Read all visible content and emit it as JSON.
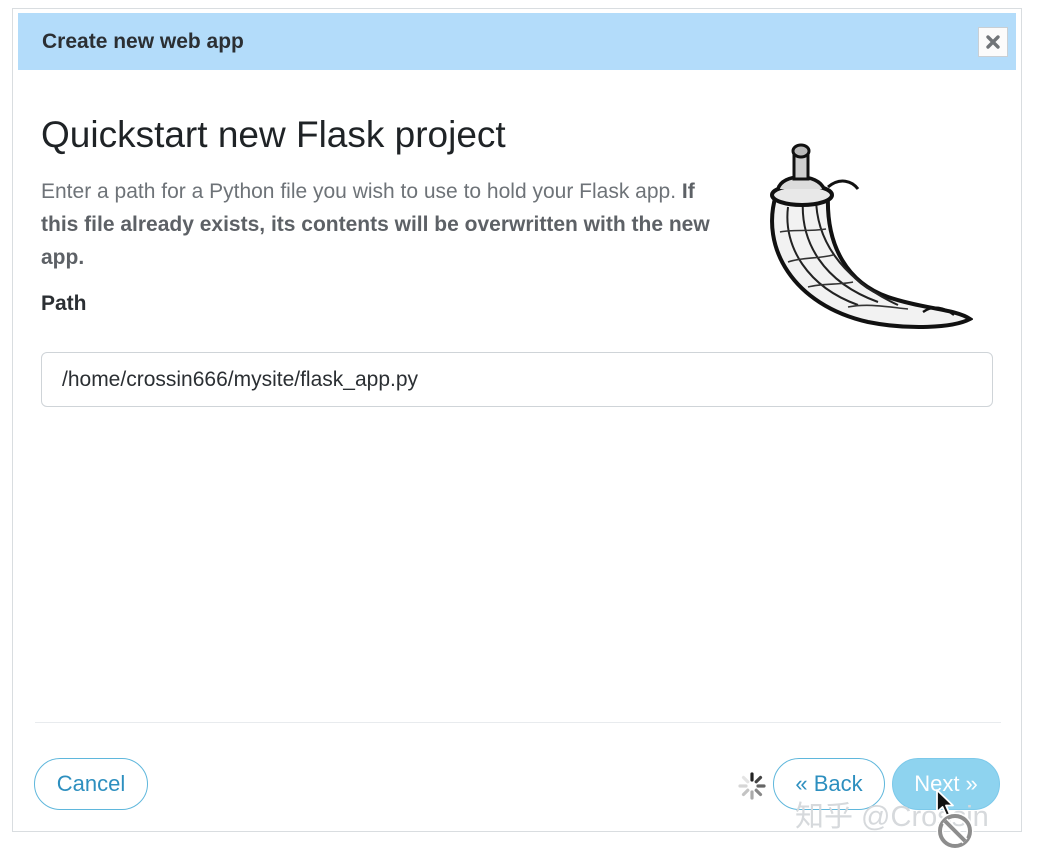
{
  "dialog": {
    "title": "Create new web app",
    "close_icon": "close-icon"
  },
  "content": {
    "heading": "Quickstart new Flask project",
    "description_plain": "Enter a path for a Python file you wish to use to hold your Flask app. ",
    "description_bold": "If this file already exists, its contents will be overwritten with the new app.",
    "path_label": "Path",
    "path_value": "/home/crossin666/mysite/flask_app.py",
    "logo_icon": "flask-horn-logo"
  },
  "footer": {
    "cancel_label": "Cancel",
    "back_label": "« Back",
    "next_label": "Next »",
    "spinner_icon": "loading-spinner-icon"
  },
  "overlay": {
    "watermark": "知乎 @Crossin",
    "cursor_icon": "arrow-cursor-icon",
    "not_allowed_icon": "not-allowed-icon"
  },
  "colors": {
    "titlebar": "#b3dcfa",
    "accent": "#2d8fbf",
    "next_button": "#8ed3ef"
  }
}
